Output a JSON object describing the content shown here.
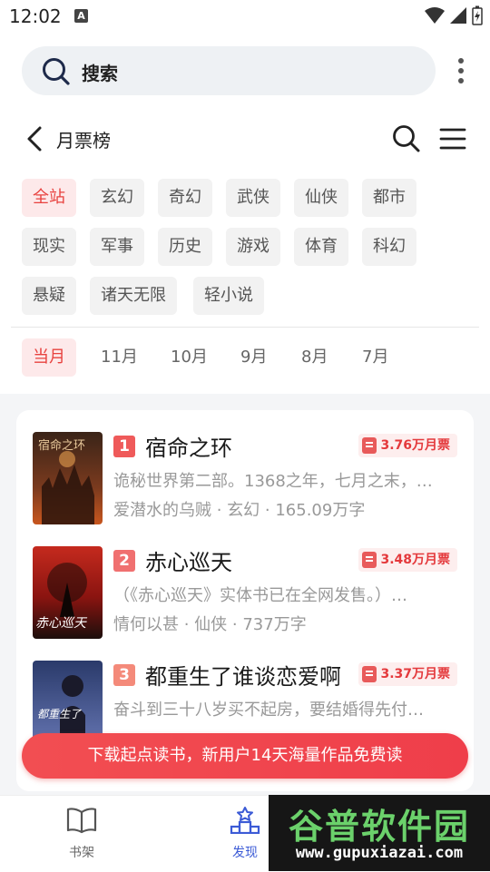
{
  "status_bar": {
    "time": "12:02",
    "notification_letter": "A"
  },
  "search": {
    "label": "搜索"
  },
  "header": {
    "title": "月票榜"
  },
  "categories": [
    "全站",
    "玄幻",
    "奇幻",
    "武侠",
    "仙侠",
    "都市",
    "现实",
    "军事",
    "历史",
    "游戏",
    "体育",
    "科幻",
    "悬疑",
    "诸天无限",
    "轻小说"
  ],
  "active_category": "全站",
  "months": [
    "当月",
    "11月",
    "10月",
    "9月",
    "8月",
    "7月"
  ],
  "active_month": "当月",
  "books": [
    {
      "rank": "1",
      "title": "宿命之环",
      "votes": "3.76万月票",
      "desc": "诡秘世界第二部。1368之年，七月之末，…",
      "author": "爱潜水的乌贼",
      "genre": "玄幻",
      "words": "165.09万字",
      "cover_text": "宿命之环"
    },
    {
      "rank": "2",
      "title": "赤心巡天",
      "votes": "3.48万月票",
      "desc": "（《赤心巡天》实体书已在全网发售。）…",
      "author": "情何以甚",
      "genre": "仙侠",
      "words": "737万字",
      "cover_text": "赤心巡天"
    },
    {
      "rank": "3",
      "title": "都重生了谁谈恋爱啊",
      "votes": "3.37万月票",
      "desc": "奋斗到三十八岁买不起房，要结婚得先付…",
      "author": "",
      "genre": "",
      "words": "",
      "cover_text": "都重生了"
    }
  ],
  "meta_separator": " · ",
  "download_banner": "下载起点读书，新用户14天海量作品免费读",
  "nav": {
    "bookshelf": "书架",
    "discover": "发现"
  },
  "watermark": {
    "top": "谷普软件园",
    "bottom": "www.gupuxiazai.com"
  },
  "colors": {
    "accent": "#e8423f",
    "nav_active": "#3c5bd6",
    "banner": "#f24e52"
  }
}
